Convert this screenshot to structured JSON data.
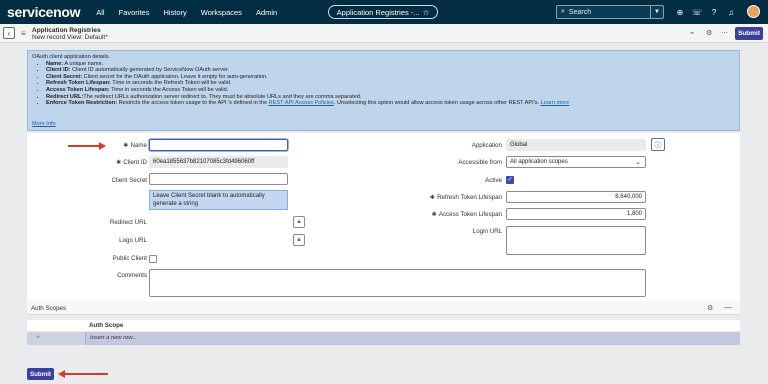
{
  "nav": {
    "logo_main": "servicenow",
    "items": [
      "All",
      "Favorites",
      "History",
      "Workspaces",
      "Admin"
    ],
    "title_pill": "Application Registries -...",
    "search_placeholder": "Search"
  },
  "form_header": {
    "title": "Application Registries",
    "subtitle": "New record  View: Default*",
    "submit_label": "Submit"
  },
  "info": {
    "intro": "OAuth client application details.",
    "bullets": [
      {
        "term": "Name:",
        "text": " A unique name."
      },
      {
        "term": "Client ID:",
        "text": " Client ID automatically generated by ServiceNow OAuth server."
      },
      {
        "term": "Client Secret:",
        "text": " Client secret for the OAuth application. Leave it empty for auto-generation."
      },
      {
        "term": "Refresh Token Lifespan:",
        "text": " Time in seconds the Refresh Token will be valid."
      },
      {
        "term": "Access Token Lifespan:",
        "text": " Time in seconds the Access Token will be valid."
      },
      {
        "term": "Redirect URL:",
        "text": "The redirect URLs authorization server redirect to. They must be absolute URLs and they are comma separated."
      }
    ],
    "restriction_term": "Enforce Token Restriction:",
    "restriction_text": " Restricts the access token usage to the API 's defined in the ",
    "restriction_link": "REST API Access Policies",
    "restriction_text2": ". Unselecting this option would allow access token usage across other REST API's. ",
    "learn_more": "Learn more",
    "more_info": "More Info"
  },
  "fields": {
    "name_label": "Name",
    "client_id_label": "Client ID",
    "client_id_value": "60ea1855637b82107085c3fd496060ff",
    "client_secret_label": "Client Secret",
    "client_secret_hint": "Leave Client Secret blank to automatically generate a string",
    "redirect_url_label": "Redirect URL",
    "logo_url_label": "Logo URL",
    "public_client_label": "Public Client",
    "comments_label": "Comments",
    "application_label": "Application",
    "application_value": "Global",
    "accessible_from_label": "Accessible from",
    "accessible_from_value": "All application scopes",
    "active_label": "Active",
    "refresh_label": "Refresh Token Lifespan",
    "refresh_value": "8,640,000",
    "access_label": "Access Token Lifespan",
    "access_value": "1,800",
    "login_url_label": "Login URL"
  },
  "related": {
    "title": "Auth Scopes",
    "column": "Auth Scope",
    "insert_row": "Insert a new row..."
  },
  "footer": {
    "submit_label": "Submit"
  }
}
